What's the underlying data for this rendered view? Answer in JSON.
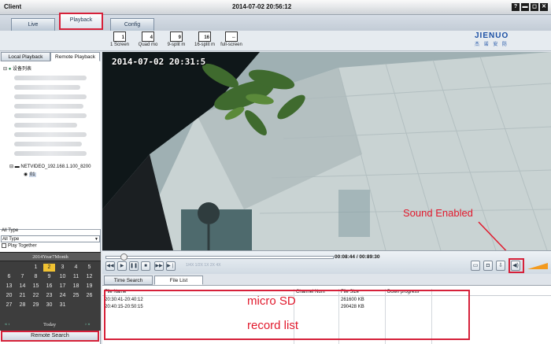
{
  "window": {
    "title": "Client",
    "clock": "2014-07-02 20:56:12",
    "buttons": [
      "?",
      "▬",
      "◻",
      "✕"
    ]
  },
  "main_tabs": [
    {
      "label": "Live"
    },
    {
      "label": "Playback"
    },
    {
      "label": "Config"
    }
  ],
  "toolbar": {
    "items": [
      {
        "label": "1 Screen",
        "icon": "single-screen-icon",
        "num": "1"
      },
      {
        "label": "Quad mo",
        "icon": "quad-screen-icon",
        "num": "4"
      },
      {
        "label": "9-split m",
        "icon": "nine-split-icon",
        "num": "9"
      },
      {
        "label": "16-split m",
        "icon": "sixteen-split-icon",
        "num": "16"
      },
      {
        "label": "full-screen",
        "icon": "fullscreen-icon",
        "num": "⇔"
      }
    ]
  },
  "logo": {
    "brand": "JIENUO",
    "tagline": "杰 诺 安 防"
  },
  "left_panel": {
    "subtabs": [
      {
        "label": "Local Playback"
      },
      {
        "label": "Remote Playback"
      }
    ],
    "tree": {
      "root": "设备列表",
      "device": "NETVIDEO_192.168.1.100_8200",
      "channel": "01"
    },
    "type_label": "All Type",
    "type_select": "All Type",
    "play_together": "Play Together",
    "calendar": {
      "header": "2014Year7Month",
      "days": [
        "1",
        "2",
        "3",
        "4",
        "5",
        "6",
        "7",
        "8",
        "9",
        "10",
        "11",
        "12",
        "13",
        "14",
        "15",
        "16",
        "17",
        "18",
        "19",
        "20",
        "21",
        "22",
        "23",
        "24",
        "25",
        "26",
        "27",
        "28",
        "29",
        "30",
        "31"
      ],
      "today": "2",
      "today_label": "Today",
      "nav_left": "« ‹",
      "nav_right": "› »"
    },
    "remote_search": "Remote Search"
  },
  "video": {
    "timestamp": "2014-07-02 20:31:5",
    "annotation": "Sound Enabled"
  },
  "playback": {
    "position": 0.08,
    "time": "00:08:44 / 00:89:30",
    "speed": "1/4X  1/2X  1X  2X  4X",
    "controls": [
      "◀◀",
      "▶",
      "❚❚",
      "■",
      "▶▶",
      "▶❘"
    ]
  },
  "bottom_tabs": [
    {
      "label": "Time Search"
    },
    {
      "label": "File List"
    }
  ],
  "file_list": {
    "columns": [
      "File Name",
      "Channel Num",
      "File Size",
      "Down progress"
    ],
    "rows": [
      {
        "name": "20:30:41-20:40:12",
        "channel": "",
        "size": "261600 KB",
        "progress": ""
      },
      {
        "name": "20:40:15-20:50:15",
        "channel": "",
        "size": "290428 KB",
        "progress": ""
      }
    ]
  },
  "annotations": {
    "line1": "micro SD",
    "line2": "record list"
  },
  "colors": {
    "highlight": "#d6213a",
    "annotation": "#e1192c",
    "calendar_bg": "#3d3d3d",
    "today": "#f0c232"
  }
}
